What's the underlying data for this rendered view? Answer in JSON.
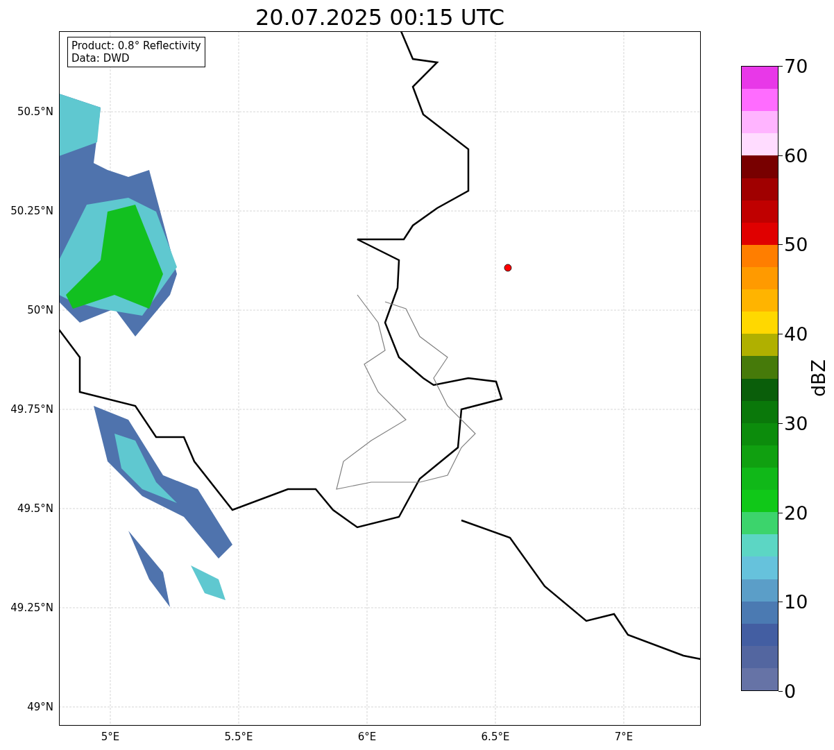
{
  "title": "20.07.2025 00:15 UTC",
  "info_box": {
    "lines": [
      "Product: 0.8° Reflectivity",
      "Data: DWD"
    ]
  },
  "map": {
    "x_ticks": [
      "5°E",
      "5.5°E",
      "6°E",
      "6.5°E",
      "7°E"
    ],
    "y_ticks": [
      "50.5°N",
      "50.25°N",
      "50°N",
      "49.75°N",
      "49.5°N",
      "49.25°N",
      "49°N"
    ]
  },
  "colorbar": {
    "label": "dBZ",
    "ticks": [
      "70",
      "60",
      "50",
      "40",
      "30",
      "20",
      "10",
      "0"
    ],
    "bands": [
      {
        "color": "#e838e8"
      },
      {
        "color": "#ff6cff"
      },
      {
        "color": "#ffb4ff"
      },
      {
        "color": "#ffdcff"
      },
      {
        "color": "#780000"
      },
      {
        "color": "#a00000"
      },
      {
        "color": "#c00000"
      },
      {
        "color": "#e00000"
      },
      {
        "color": "#ff7e00"
      },
      {
        "color": "#ff9a00"
      },
      {
        "color": "#ffb400"
      },
      {
        "color": "#ffd800"
      },
      {
        "color": "#b0b000"
      },
      {
        "color": "#467a0a"
      },
      {
        "color": "#0a5e0a"
      },
      {
        "color": "#0a780a"
      },
      {
        "color": "#0c8c0c"
      },
      {
        "color": "#10a010"
      },
      {
        "color": "#10b818"
      },
      {
        "color": "#10c818"
      },
      {
        "color": "#3cd46c"
      },
      {
        "color": "#5cd6c4"
      },
      {
        "color": "#66c2dc"
      },
      {
        "color": "#5b9ec8"
      },
      {
        "color": "#4b7ab2"
      },
      {
        "color": "#435ea2"
      },
      {
        "color": "#5366a0"
      },
      {
        "color": "#6673a6"
      }
    ]
  }
}
